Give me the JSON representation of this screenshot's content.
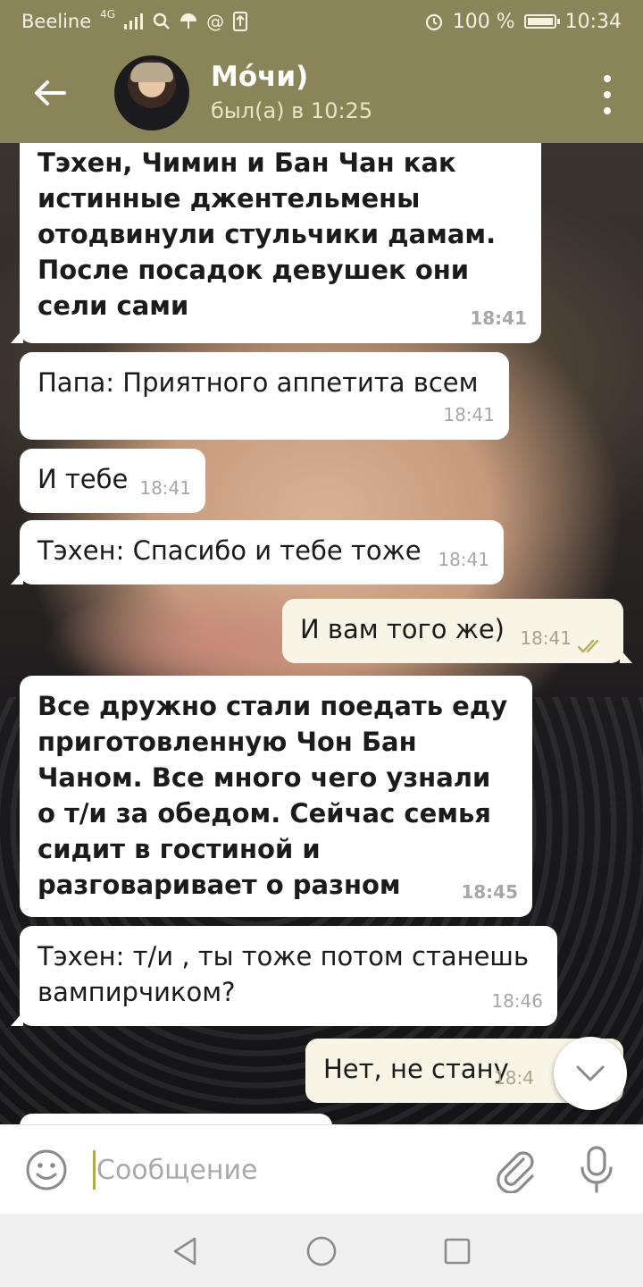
{
  "status_bar": {
    "carrier": "Beeline",
    "network": "4G",
    "battery": "100 %",
    "battery_level": 1.0,
    "time": "10:34"
  },
  "header": {
    "contact_name": "Мо́чи)",
    "last_seen": "был(а) в 10:25"
  },
  "messages": [
    {
      "dir": "in",
      "bold": true,
      "text": "Тэхен, Чимин и Бан Чан как истинные джентельмены отодвинули стульчики дамам. После посадок девушек они сели сами",
      "time": "18:41"
    },
    {
      "dir": "in",
      "bold": false,
      "text": "Папа: Приятного аппетита всем",
      "time": "18:41"
    },
    {
      "dir": "in",
      "bold": false,
      "text": "И тебе",
      "time": "18:41"
    },
    {
      "dir": "in",
      "bold": false,
      "text": "Тэхен: Спасибо и тебе тоже",
      "time": "18:41"
    },
    {
      "dir": "out",
      "bold": false,
      "text": "И вам того же)",
      "time": "18:41",
      "read": true
    },
    {
      "dir": "in",
      "bold": true,
      "text": "Все дружно стали поедать еду приготовленную Чон Бан Чаном. Все много чего узнали о т/и за обедом. Сейчас семья сидит в гостиной и разговаривает о разном",
      "time": "18:45"
    },
    {
      "dir": "in",
      "bold": false,
      "text": "Тэхен: т/и , ты тоже потом станешь вампирчиком?",
      "time": "18:46"
    },
    {
      "dir": "out",
      "bold": false,
      "text": "Нет, не стану",
      "time": "18:4"
    }
  ],
  "input": {
    "placeholder": "Сообщение"
  },
  "colors": {
    "header": "#8a8558",
    "bubble_in": "#ffffff",
    "bubble_out": "#f8f4e6",
    "read_check": "#b8ad5a"
  },
  "icons": [
    "back-arrow-icon",
    "more-vert-icon",
    "emoji-icon",
    "paperclip-icon",
    "mic-icon",
    "chevron-down-icon",
    "nav-back-icon",
    "nav-home-icon",
    "nav-recents-icon"
  ]
}
